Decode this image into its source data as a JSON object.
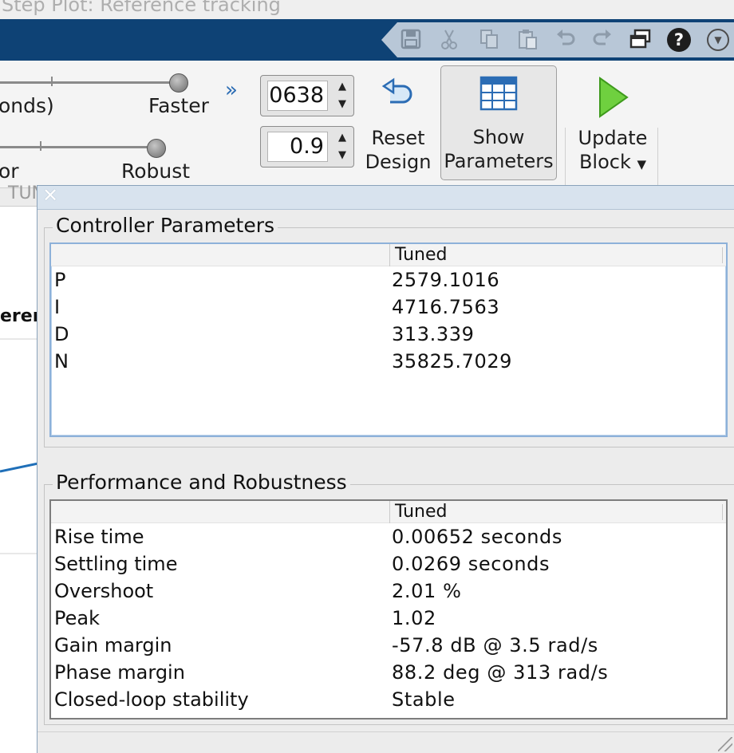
{
  "window": {
    "title": "Step Plot: Reference tracking"
  },
  "quick_access": {
    "icons": [
      "save-icon",
      "cut-icon",
      "copy-icon",
      "paste-icon",
      "undo-icon",
      "redo-icon",
      "restore-window-icon",
      "help-icon",
      "menu-icon"
    ],
    "help_glyph": "?",
    "menu_glyph": "▼"
  },
  "toolstrip": {
    "response_time": {
      "left_label": "onds)",
      "right_label": "Faster",
      "value": "0638",
      "value_fraction": 1.0
    },
    "transient_behavior": {
      "left_label": "or",
      "right_label": "Robust",
      "value": "0.9",
      "value_fraction": 0.9
    },
    "expand_glyph": "»",
    "reset_design": {
      "line1": "Reset",
      "line2": "Design"
    },
    "show_parameters": {
      "line1": "Show",
      "line2": "Parameters"
    },
    "update_block": {
      "line1": "Update",
      "line2": "Block"
    },
    "tab_fragment": "TUN"
  },
  "background": {
    "plot_label_fragment": "erenc"
  },
  "dialog": {
    "close_glyph": "✕",
    "controller_parameters": {
      "title": "Controller Parameters",
      "column": "Tuned",
      "rows": [
        {
          "name": "P",
          "value": "2579.1016"
        },
        {
          "name": "I",
          "value": "4716.7563"
        },
        {
          "name": "D",
          "value": "313.339"
        },
        {
          "name": "N",
          "value": "35825.7029"
        }
      ]
    },
    "performance": {
      "title": "Performance and Robustness",
      "column": "Tuned",
      "rows": [
        {
          "name": "Rise time",
          "value": "0.00652 seconds"
        },
        {
          "name": "Settling time",
          "value": "0.0269 seconds"
        },
        {
          "name": "Overshoot",
          "value": "2.01 %"
        },
        {
          "name": "Peak",
          "value": "1.02"
        },
        {
          "name": "Gain margin",
          "value": "-57.8 dB @ 3.5 rad/s"
        },
        {
          "name": "Phase margin",
          "value": "88.2 deg @ 313 rad/s"
        },
        {
          "name": "Closed-loop stability",
          "value": "Stable"
        }
      ]
    }
  },
  "colors": {
    "titlebar": "#0e4275",
    "accent": "#2b6cb4",
    "selection": "#8db1d9"
  }
}
